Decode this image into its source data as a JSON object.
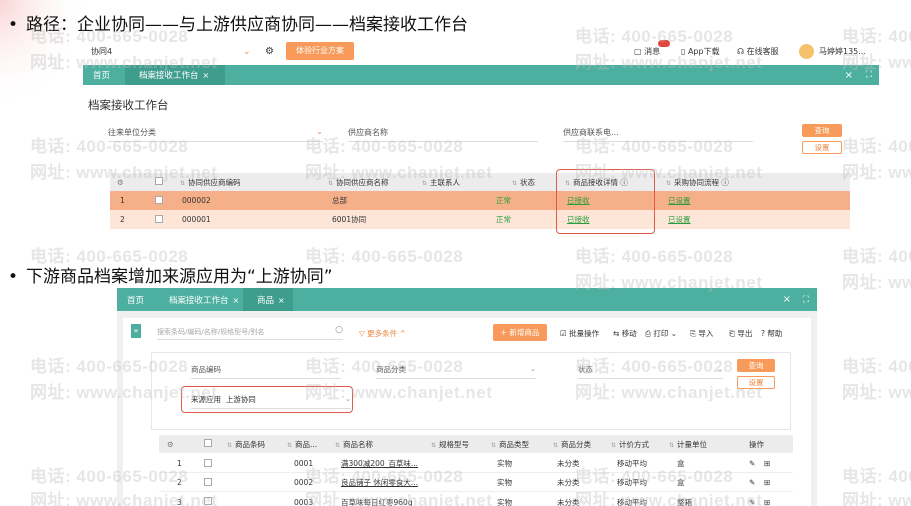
{
  "watermark": {
    "phone": "电话: 400-665-0028",
    "site": "网址: www.chanjet.net"
  },
  "slide": {
    "bullet1": "路径：企业协同——与上游供应商协同——档案接收工作台",
    "bullet2": "下游商品档案增加来源应用为“上游协同”",
    "bullet_glyph": "•"
  },
  "shot1": {
    "topbar": {
      "app_name": "协同4",
      "solution_btn": "体验行业方案",
      "message": "消息",
      "app_download": "App下载",
      "online_service": "在线客服",
      "user": "马婷婷135..."
    },
    "nav": {
      "home": "首页",
      "tab_active": "档案接收工作台",
      "close_glyph": "×",
      "fullscreen_glyph": "⛶"
    },
    "page_title": "档案接收工作台",
    "filters": {
      "upstream_category": "往来单位分类",
      "supplier_name": "供应商名称",
      "supplier_contact": "供应商联系电..."
    },
    "buttons": {
      "query": "查询",
      "settings": "设置"
    },
    "table": {
      "headers": [
        "协同供应商编码",
        "协同供应商名称",
        "主联系人",
        "状态",
        "商品接收详情 ⓘ",
        "采购协同流程 ⓘ"
      ],
      "rows": [
        {
          "index": "1",
          "code": "000002",
          "name": "总部",
          "contact": "",
          "status": "正常",
          "receive": "已接收",
          "flow": "已设置"
        },
        {
          "index": "2",
          "code": "000001",
          "name": "6001协同",
          "contact": "",
          "status": "正常",
          "receive": "已接收",
          "flow": "已设置"
        }
      ]
    }
  },
  "shot2": {
    "nav": {
      "home": "首页",
      "tab1": "档案接收工作台",
      "tab2": "商品"
    },
    "search_placeholder": "搜索条码/编码/名称/规格型号/别名",
    "more_conditions": "更多条件",
    "toolbar": {
      "new_product": "+ 新增商品",
      "batch": "批量操作",
      "move": "移动",
      "print": "打印",
      "import": "导入",
      "export": "导出",
      "help": "帮助"
    },
    "filters": {
      "product_code": "商品编码",
      "product_category": "商品分类",
      "status": "状态",
      "source_label": "来源应用",
      "source_value": "上游协同"
    },
    "buttons": {
      "query": "查询",
      "settings": "设置"
    },
    "table": {
      "headers": [
        "商品条码",
        "商品...",
        "商品名称",
        "规格型号",
        "商品类型",
        "商品分类",
        "计价方式",
        "计量单位",
        "操作"
      ],
      "rows": [
        {
          "index": "1",
          "barcode": "",
          "code": "0001",
          "name": "满300减200_百草味...",
          "spec": "",
          "type": "实物",
          "category": "未分类",
          "pricing": "移动平均",
          "unit": "盒"
        },
        {
          "index": "2",
          "barcode": "",
          "code": "0002",
          "name": "良品铺子 休闲零食大...",
          "spec": "",
          "type": "实物",
          "category": "未分类",
          "pricing": "移动平均",
          "unit": "盒"
        },
        {
          "index": "3",
          "barcode": "",
          "code": "0003",
          "name": "百草味每日红枣960g",
          "spec": "",
          "type": "实物",
          "category": "未分类",
          "pricing": "移动平均",
          "unit": "整箱"
        }
      ]
    }
  },
  "colors": {
    "teal": "#4caf9f",
    "orange": "#f79a5a",
    "row_selected": "#f5b08a",
    "row_light": "#fde6d8",
    "green": "#2a9d3e",
    "red_box": "#e05a4a"
  }
}
